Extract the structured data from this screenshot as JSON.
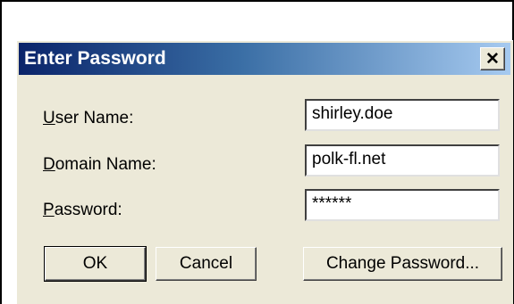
{
  "dialog": {
    "title": "Enter Password",
    "close_glyph": "✕",
    "fields": {
      "user_name": {
        "label_accel": "U",
        "label_rest": "ser Name:",
        "value": "shirley.doe"
      },
      "domain_name": {
        "label_accel": "D",
        "label_rest": "omain Name:",
        "value": "polk-fl.net"
      },
      "password": {
        "label_accel": "P",
        "label_rest": "assword:",
        "value": "******"
      }
    },
    "buttons": {
      "ok": "OK",
      "cancel": "Cancel",
      "change_password": "Change Password..."
    }
  }
}
